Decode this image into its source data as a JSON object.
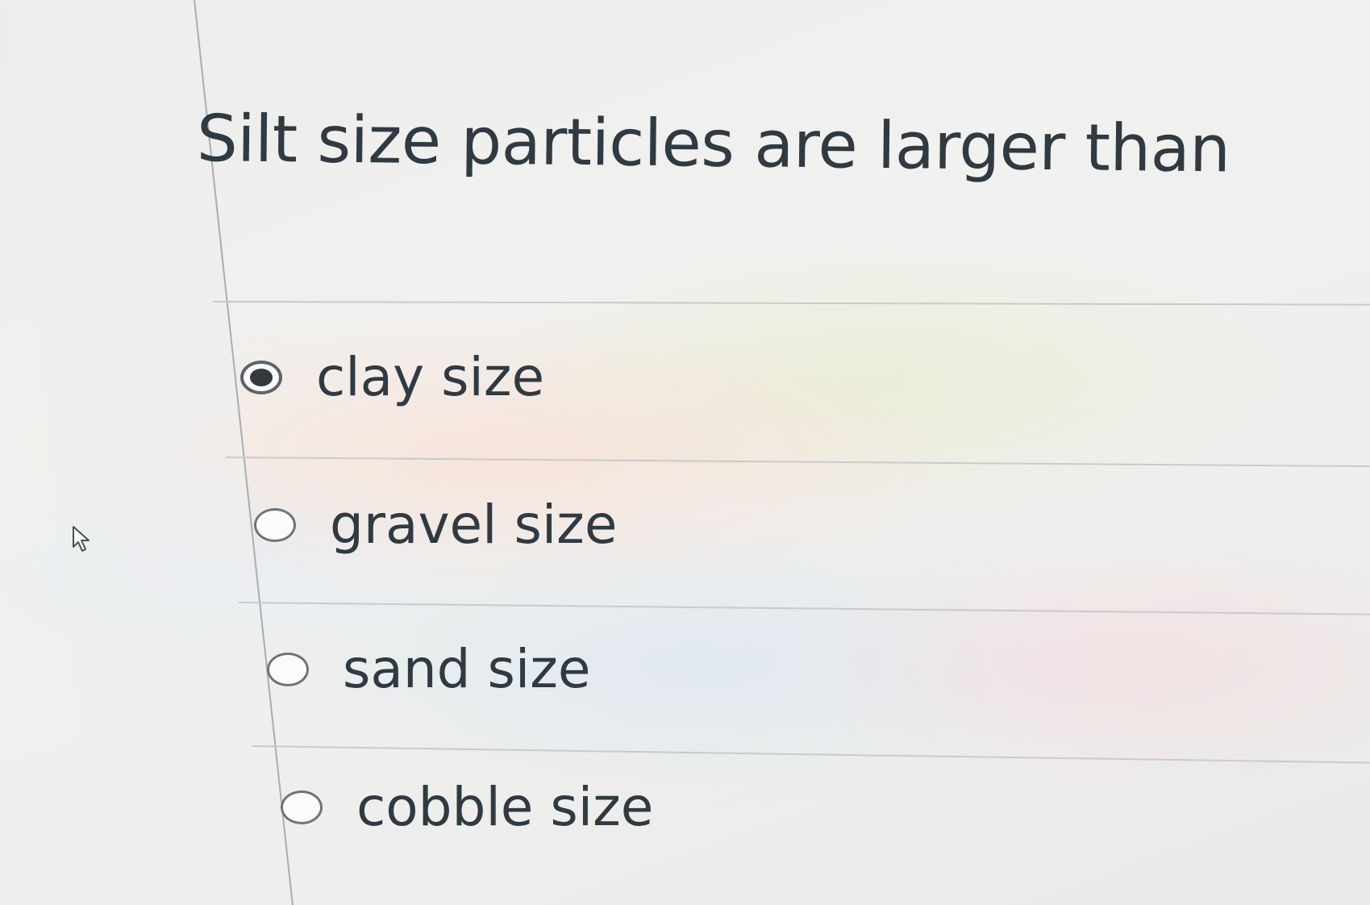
{
  "question": {
    "text": "Silt size particles are larger than"
  },
  "answers": [
    {
      "label": "clay size",
      "selected": true
    },
    {
      "label": "gravel size",
      "selected": false
    },
    {
      "label": "sand size",
      "selected": false
    },
    {
      "label": "cobble size",
      "selected": false
    }
  ],
  "icons": {
    "pointer": "mouse-pointer-icon"
  },
  "colors": {
    "text": "#2f3a42",
    "radio_border": "#6e7479",
    "radio_fill": "#33393e",
    "divider": "#c8cbcd"
  }
}
